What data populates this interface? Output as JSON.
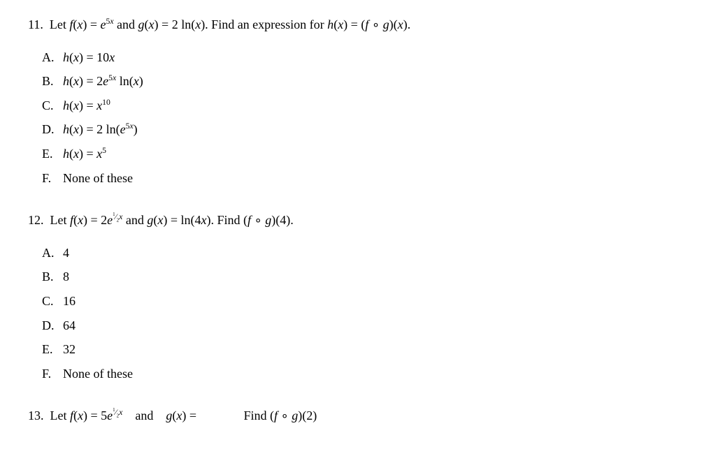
{
  "questions": [
    {
      "id": "q11",
      "number": "11.",
      "prompt_html": "Let <i>f</i>(<i>x</i>) = <i>e</i><sup>5<i>x</i></sup> and <i>g</i>(<i>x</i>) = 2 ln(<i>x</i>). Find an expression for <i>h</i>(<i>x</i>) = (<i>f</i> &#8728; <i>g</i>)(<i>x</i>).",
      "answers": [
        {
          "letter": "A.",
          "html": "<i>h</i>(<i>x</i>) = 10<i>x</i>"
        },
        {
          "letter": "B.",
          "html": "<i>h</i>(<i>x</i>) = 2<i>e</i><sup>5<i>x</i></sup> ln(<i>x</i>)"
        },
        {
          "letter": "C.",
          "html": "<i>h</i>(<i>x</i>) = <i>x</i><sup>10</sup>"
        },
        {
          "letter": "D.",
          "html": "<i>h</i>(<i>x</i>) = 2 ln(<i>e</i><sup>5<i>x</i></sup>)"
        },
        {
          "letter": "E.",
          "html": "<i>h</i>(<i>x</i>) = <i>x</i><sup>5</sup>"
        },
        {
          "letter": "F.",
          "html": "None of these"
        }
      ]
    },
    {
      "id": "q12",
      "number": "12.",
      "prompt_html": "Let <i>f</i>(<i>x</i>) = 2<i>e</i><sup><sup>1</sup>&frasl;<sub>2</sub><i>x</i></sup> and <i>g</i>(<i>x</i>) = ln(4<i>x</i>). Find (<i>f</i> &#8728; <i>g</i>)(4).",
      "answers": [
        {
          "letter": "A.",
          "html": "4"
        },
        {
          "letter": "B.",
          "html": "8"
        },
        {
          "letter": "C.",
          "html": "16"
        },
        {
          "letter": "D.",
          "html": "64"
        },
        {
          "letter": "E.",
          "html": "32"
        },
        {
          "letter": "F.",
          "html": "None of these"
        }
      ]
    }
  ],
  "partial_q13": {
    "number": "13.",
    "prompt_html": "Let <i>f</i>(<i>x</i>) = 5<i>e</i><sup><sup>1</sup>&frasl;<sub>2</sub><i>x</i></sup> and <i>g</i>(<i>x</i>) = &#8230; Find (<i>f</i> &#8728; <i>g</i>)(2)"
  }
}
